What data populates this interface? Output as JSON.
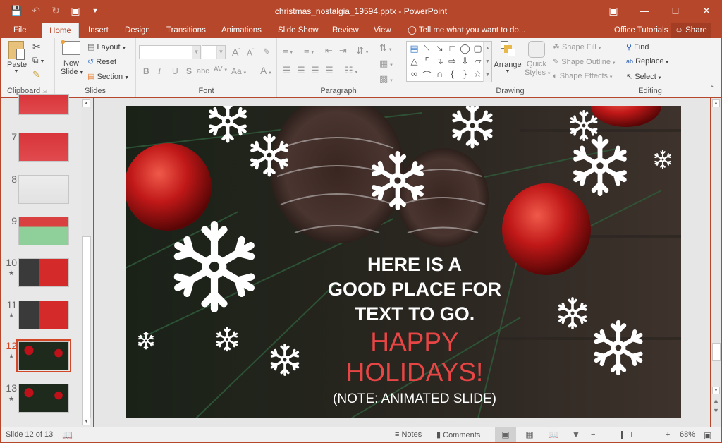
{
  "window": {
    "title": "christmas_nostalgia_19594.pptx - PowerPoint",
    "controls": [
      "ribbon-display-options",
      "minimize",
      "maximize",
      "close"
    ]
  },
  "quick_access": {
    "save": "save-icon",
    "undo": "undo-icon",
    "redo": "redo-icon",
    "present": "start-from-beginning-icon",
    "customize": "customize-qat-icon"
  },
  "tabs": [
    {
      "label": "File"
    },
    {
      "label": "Home",
      "active": true
    },
    {
      "label": "Insert"
    },
    {
      "label": "Design"
    },
    {
      "label": "Transitions"
    },
    {
      "label": "Animations"
    },
    {
      "label": "Slide Show"
    },
    {
      "label": "Review"
    },
    {
      "label": "View"
    }
  ],
  "tell_me": "Tell me what you want to do...",
  "office_tutorials": "Office Tutorials",
  "share": "Share",
  "ribbon": {
    "clipboard": {
      "label": "Clipboard",
      "paste": "Paste"
    },
    "slides": {
      "label": "Slides",
      "new_slide_1": "New",
      "new_slide_2": "Slide",
      "layout": "Layout",
      "reset": "Reset",
      "section": "Section"
    },
    "font": {
      "label": "Font",
      "font_name": "",
      "font_size": "",
      "bold": "B",
      "italic": "I",
      "underline": "U",
      "shadow": "S",
      "strike": "abc",
      "spacing": "AV",
      "case": "Aa",
      "color": "A",
      "grow": "A",
      "shrink": "A"
    },
    "paragraph": {
      "label": "Paragraph"
    },
    "drawing": {
      "label": "Drawing",
      "arrange": "Arrange",
      "quick_styles_1": "Quick",
      "quick_styles_2": "Styles",
      "shape_fill": "Shape Fill",
      "shape_outline": "Shape Outline",
      "shape_effects": "Shape Effects"
    },
    "editing": {
      "label": "Editing",
      "find": "Find",
      "replace": "Replace",
      "select": "Select"
    }
  },
  "thumbnails": [
    {
      "num": "",
      "theme": "red",
      "star": false
    },
    {
      "num": "7",
      "theme": "red",
      "star": false
    },
    {
      "num": "8",
      "theme": "light",
      "star": false
    },
    {
      "num": "9",
      "theme": "green",
      "star": false
    },
    {
      "num": "10",
      "theme": "dark-red",
      "star": true
    },
    {
      "num": "11",
      "theme": "dark-red",
      "star": true
    },
    {
      "num": "12",
      "theme": "xmas",
      "star": true,
      "selected": true
    },
    {
      "num": "13",
      "theme": "xmas",
      "star": true
    }
  ],
  "slide": {
    "headline_1": "HERE IS A",
    "headline_2": "GOOD PLACE FOR",
    "headline_3": "TEXT TO GO.",
    "greeting_1": "HAPPY",
    "greeting_2": "HOLIDAYS!",
    "note": "(NOTE: ANIMATED SLIDE)",
    "accent_color": "#e84545"
  },
  "status": {
    "slide_info": "Slide 12 of 13",
    "notes": "Notes",
    "comments": "Comments",
    "zoom": "68%",
    "zoom_fraction": 0.34
  },
  "colors": {
    "brand": "#b7472a",
    "selected": "#d24726"
  }
}
